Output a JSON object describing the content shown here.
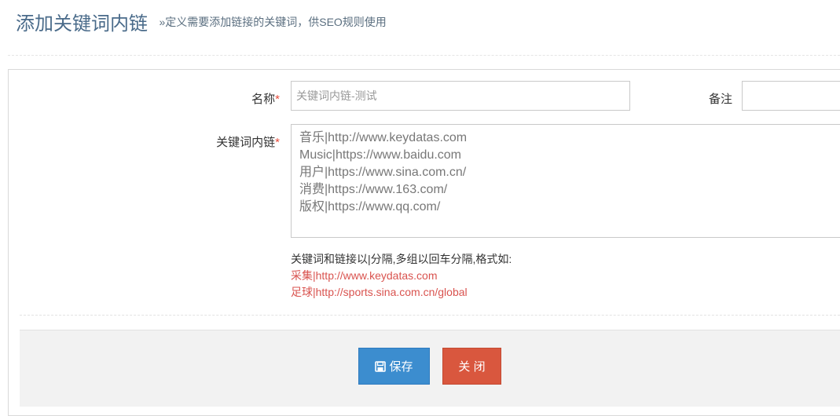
{
  "header": {
    "title": "添加关键词内链",
    "subtitle": "»定义需要添加链接的关键词，供SEO规则使用"
  },
  "form": {
    "name": {
      "label": "名称",
      "required_mark": "*",
      "value": "关键词内链-测试"
    },
    "remark": {
      "label": "备注",
      "value": ""
    },
    "keywords": {
      "label": "关键词内链",
      "required_mark": "*",
      "value": "音乐|http://www.keydatas.com\nMusic|https://www.baidu.com\n用户|https://www.sina.com.cn/\n消费|https://www.163.com/\n版权|https://www.qq.com/"
    },
    "help": {
      "instruction": "关键词和链接以|分隔,多组以回车分隔,格式如:",
      "example1": "采集|http://www.keydatas.com",
      "example2": "足球|http://sports.sina.com.cn/global"
    }
  },
  "actions": {
    "save_label": "保存",
    "save_icon": "save-icon",
    "close_label": "关 闭"
  },
  "colors": {
    "title": "#4a6b8a",
    "required": "#e74c3c",
    "example": "#d9534f",
    "save_button": "#3c8dcf",
    "close_button": "#d9573e",
    "footer_bg": "#f2f2f2"
  }
}
